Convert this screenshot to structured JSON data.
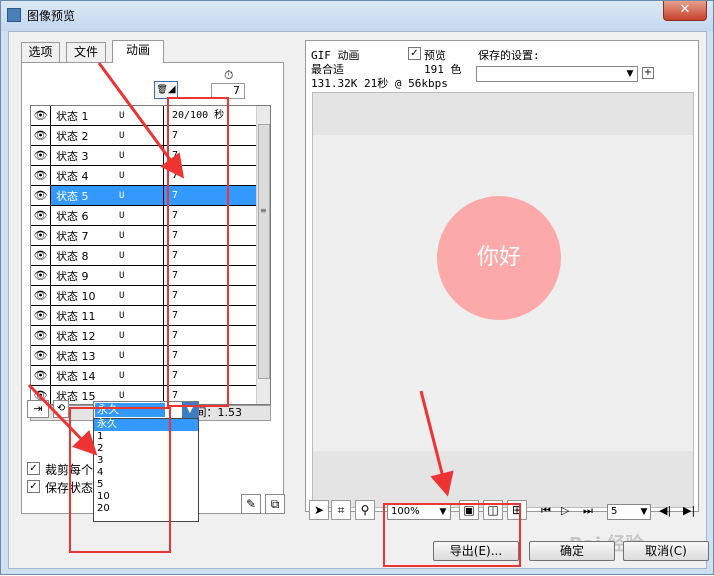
{
  "window": {
    "title": "图像预览",
    "close_glyph": "✕"
  },
  "tabs": [
    "选项",
    "文件",
    "动画"
  ],
  "toolbar": {
    "delay_value": "7",
    "timer_glyph": "⏱",
    "trash_glyph": "🗑"
  },
  "states": [
    {
      "name": "状态 1",
      "u": "U",
      "delay": "20/100 秒"
    },
    {
      "name": "状态 2",
      "u": "U",
      "delay": "7"
    },
    {
      "name": "状态 3",
      "u": "U",
      "delay": "7"
    },
    {
      "name": "状态 4",
      "u": "U",
      "delay": "7"
    },
    {
      "name": "状态 5",
      "u": "U",
      "delay": "7"
    },
    {
      "name": "状态 6",
      "u": "U",
      "delay": "7"
    },
    {
      "name": "状态 7",
      "u": "U",
      "delay": "7"
    },
    {
      "name": "状态 8",
      "u": "U",
      "delay": "7"
    },
    {
      "name": "状态 9",
      "u": "U",
      "delay": "7"
    },
    {
      "name": "状态 10",
      "u": "U",
      "delay": "7"
    },
    {
      "name": "状态 11",
      "u": "U",
      "delay": "7"
    },
    {
      "name": "状态 12",
      "u": "U",
      "delay": "7"
    },
    {
      "name": "状态 13",
      "u": "U",
      "delay": "7"
    },
    {
      "name": "状态 14",
      "u": "U",
      "delay": "7"
    },
    {
      "name": "状态 15",
      "u": "U",
      "delay": "7"
    }
  ],
  "selected_state_index": 4,
  "runtime_label": "运行时间：1.53",
  "loop": {
    "selected": "永久",
    "options": [
      "永久",
      "1",
      "2",
      "3",
      "4",
      "5",
      "10",
      "20"
    ]
  },
  "checkboxes": [
    {
      "label": "裁剪每个",
      "checked": true
    },
    {
      "label": "保存状态",
      "checked": true
    }
  ],
  "preview_info": {
    "format": "GIF 动画",
    "fit": "最合适",
    "stats": "131.32K  21秒 @ 56kbps",
    "preview_label": "预览",
    "colors": "191 色",
    "saved_settings_label": "保存的设置:"
  },
  "canvas_text": "你好",
  "zoom": "100%",
  "frame": "5",
  "buttons": {
    "export": "导出(E)...",
    "ok": "确定",
    "cancel": "取消(C)"
  },
  "watermark": "Bai 经验",
  "annotation_color": "#ee3333",
  "selection_color": "#3399ff",
  "bubble_color": "#fca9a9"
}
